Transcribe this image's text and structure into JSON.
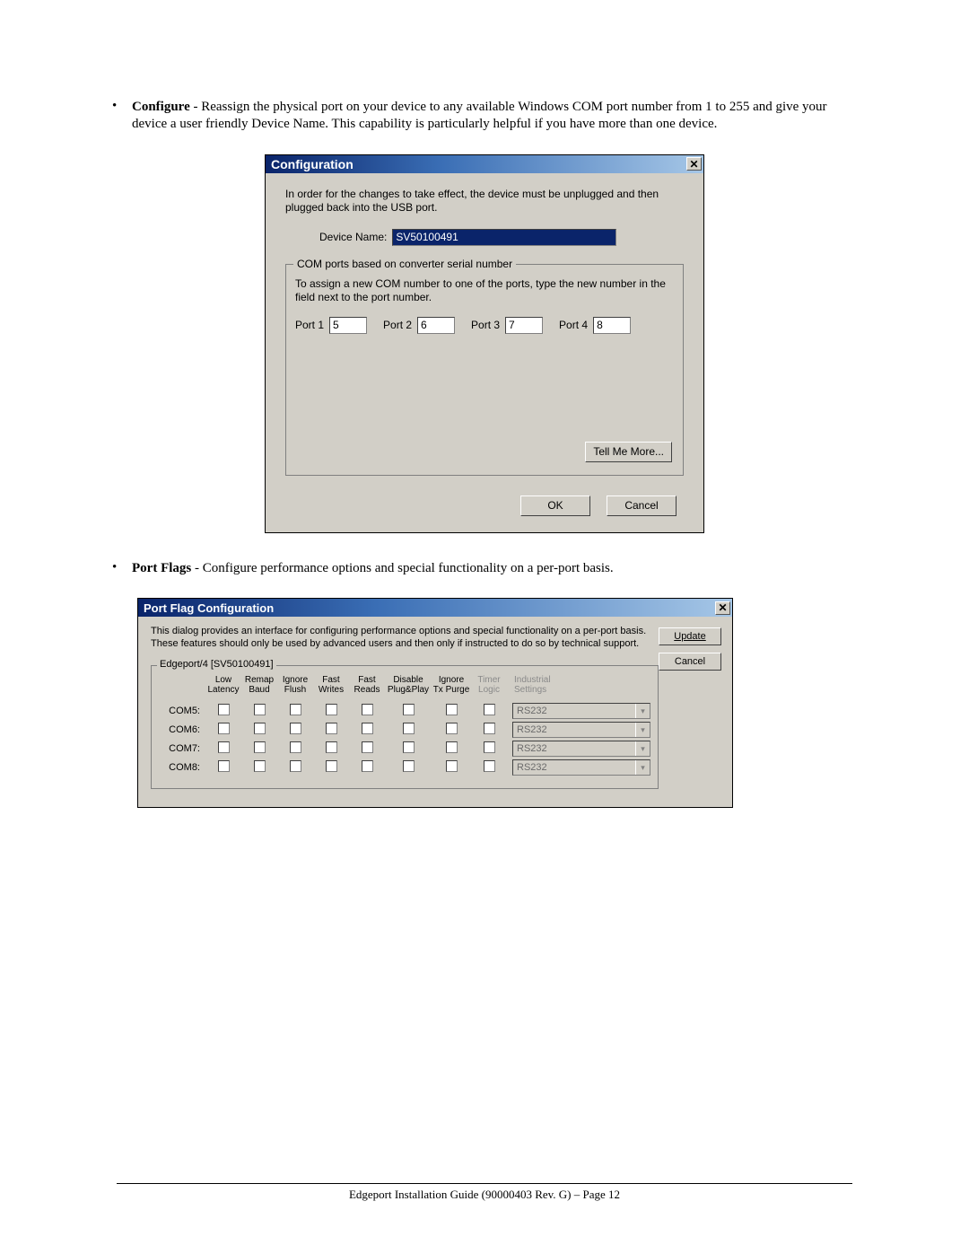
{
  "doc": {
    "bullet1_bold": "Configure",
    "bullet1_rest": " - Reassign the physical port on your device to any available Windows COM port number from 1 to 255 and give your device a user friendly Device Name. This capability is particularly helpful if you have more than one device.",
    "bullet2_bold": "Port Flags",
    "bullet2_rest": " - Configure performance options and special functionality on a per-port basis.",
    "footer": "Edgeport Installation Guide (90000403 Rev. G) – Page 12"
  },
  "config_dialog": {
    "title": "Configuration",
    "close": "✕",
    "notice": "In order for the changes to take effect, the device must be unplugged and then plugged back into the USB port.",
    "device_name_label": "Device Name:",
    "device_name_value": "SV50100491",
    "group_legend": "COM ports based on converter serial number",
    "group_desc": "To assign a new COM number to one of the ports, type the new number in the field next to the port number.",
    "ports": [
      {
        "label": "Port 1",
        "value": "5"
      },
      {
        "label": "Port 2",
        "value": "6"
      },
      {
        "label": "Port 3",
        "value": "7"
      },
      {
        "label": "Port 4",
        "value": "8"
      }
    ],
    "tell_me_more": "Tell Me More...",
    "ok": "OK",
    "cancel": "Cancel"
  },
  "portflag_dialog": {
    "title": "Port Flag Configuration",
    "close": "✕",
    "intro": "This dialog provides an interface for configuring performance options and special functionality on a per-port basis. These features should only be used by advanced users and then only if instructed to do so by technical support.",
    "update": "Update",
    "cancel": "Cancel",
    "group_legend": "Edgeport/4 [SV50100491]",
    "headers": [
      "Low\nLatency",
      "Remap\nBaud",
      "Ignore\nFlush",
      "Fast\nWrites",
      "Fast\nReads",
      "Disable\nPlug&Play",
      "Ignore\nTx Purge",
      "Timer\nLogic",
      "Industrial\nSettings"
    ],
    "rows": [
      {
        "name": "COM5:",
        "mode": "RS232"
      },
      {
        "name": "COM6:",
        "mode": "RS232"
      },
      {
        "name": "COM7:",
        "mode": "RS232"
      },
      {
        "name": "COM8:",
        "mode": "RS232"
      }
    ]
  }
}
